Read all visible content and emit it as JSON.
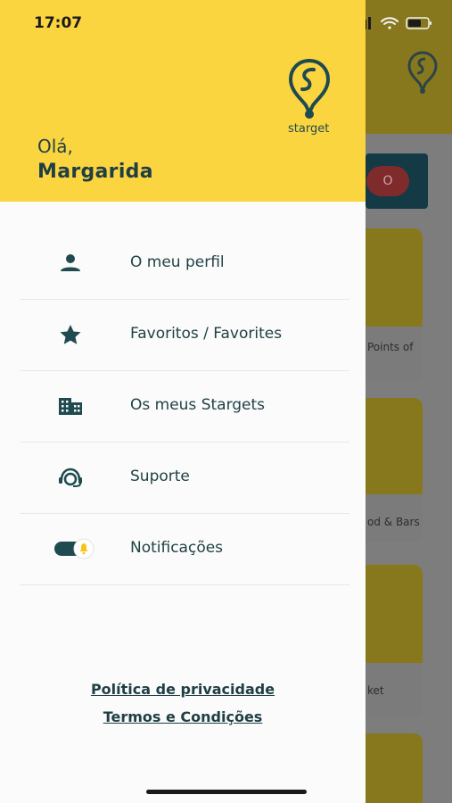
{
  "status_bar": {
    "time": "17:07"
  },
  "brand": {
    "name": "starget"
  },
  "greeting": {
    "hello": "Olá,",
    "user_name": "Margarida"
  },
  "menu": {
    "items": [
      {
        "label": "O meu perfil",
        "icon": "person-icon"
      },
      {
        "label": "Favoritos / Favorites",
        "icon": "star-icon"
      },
      {
        "label": "Os meus Stargets",
        "icon": "building-icon"
      },
      {
        "label": "Suporte",
        "icon": "support-headset-icon"
      },
      {
        "label": "Notificações",
        "icon": "notification-toggle-icon"
      }
    ]
  },
  "footer_links": {
    "privacy": "Política de privacidade",
    "terms": "Termos e Condições"
  },
  "background": {
    "search_button": "O",
    "cards": [
      "Points of",
      "od & Bars",
      "ket"
    ]
  },
  "colors": {
    "accent_yellow": "#fbd540",
    "primary_dark": "#1f3f45",
    "drawer_bg": "#fafbfa"
  }
}
